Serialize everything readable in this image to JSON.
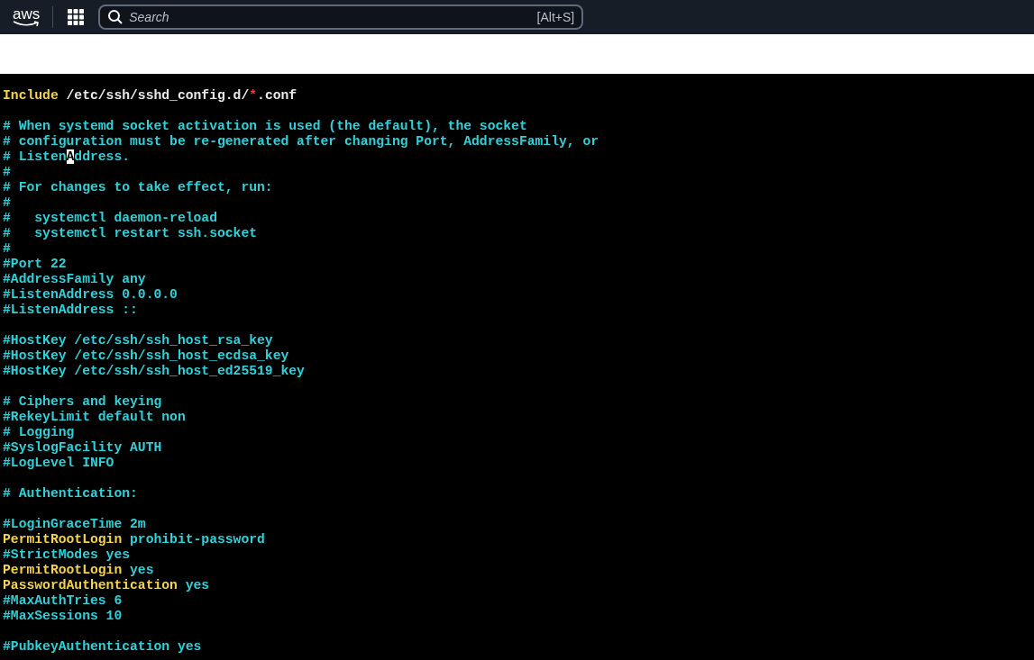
{
  "top_bar": {
    "logo": "aws",
    "search": {
      "placeholder": "Search",
      "shortcut": "[Alt+S]"
    }
  },
  "terminal": {
    "lines": [
      {
        "kind": "text",
        "segments": [
          {
            "kind": "keyword",
            "text": "Include"
          },
          {
            "kind": "plain",
            "text": " /etc/ssh/sshd_config.d/"
          },
          {
            "kind": "glob",
            "text": "*"
          },
          {
            "kind": "plain",
            "text": ".conf"
          }
        ]
      },
      {
        "kind": "blank"
      },
      {
        "kind": "text",
        "segments": [
          {
            "kind": "comment",
            "text": "# When systemd socket activation is used (the default), the socket"
          }
        ]
      },
      {
        "kind": "text",
        "segments": [
          {
            "kind": "comment",
            "text": "# configuration must be re-generated after changing Port, AddressFamily, or"
          }
        ]
      },
      {
        "kind": "text",
        "segments": [
          {
            "kind": "comment",
            "text": "# Listen"
          },
          {
            "kind": "cursor",
            "text": "A"
          },
          {
            "kind": "comment",
            "text": "ddress."
          }
        ]
      },
      {
        "kind": "text",
        "segments": [
          {
            "kind": "comment",
            "text": "#"
          }
        ]
      },
      {
        "kind": "text",
        "segments": [
          {
            "kind": "comment",
            "text": "# For changes to take effect, run:"
          }
        ]
      },
      {
        "kind": "text",
        "segments": [
          {
            "kind": "comment",
            "text": "#"
          }
        ]
      },
      {
        "kind": "text",
        "segments": [
          {
            "kind": "comment",
            "text": "#   systemctl daemon-reload"
          }
        ]
      },
      {
        "kind": "text",
        "segments": [
          {
            "kind": "comment",
            "text": "#   systemctl restart ssh.socket"
          }
        ]
      },
      {
        "kind": "text",
        "segments": [
          {
            "kind": "comment",
            "text": "#"
          }
        ]
      },
      {
        "kind": "text",
        "segments": [
          {
            "kind": "comment",
            "text": "#Port 22"
          }
        ]
      },
      {
        "kind": "text",
        "segments": [
          {
            "kind": "comment",
            "text": "#AddressFamily any"
          }
        ]
      },
      {
        "kind": "text",
        "segments": [
          {
            "kind": "comment",
            "text": "#ListenAddress 0.0.0.0"
          }
        ]
      },
      {
        "kind": "text",
        "segments": [
          {
            "kind": "comment",
            "text": "#ListenAddress ::"
          }
        ]
      },
      {
        "kind": "blank"
      },
      {
        "kind": "text",
        "segments": [
          {
            "kind": "comment",
            "text": "#HostKey /etc/ssh/ssh_host_rsa_key"
          }
        ]
      },
      {
        "kind": "text",
        "segments": [
          {
            "kind": "comment",
            "text": "#HostKey /etc/ssh/ssh_host_ecdsa_key"
          }
        ]
      },
      {
        "kind": "text",
        "segments": [
          {
            "kind": "comment",
            "text": "#HostKey /etc/ssh/ssh_host_ed25519_key"
          }
        ]
      },
      {
        "kind": "blank"
      },
      {
        "kind": "text",
        "segments": [
          {
            "kind": "comment",
            "text": "# Ciphers and keying"
          }
        ]
      },
      {
        "kind": "text",
        "segments": [
          {
            "kind": "comment",
            "text": "#RekeyLimit default non"
          }
        ]
      },
      {
        "kind": "text",
        "segments": [
          {
            "kind": "comment",
            "text": "# Logging"
          }
        ]
      },
      {
        "kind": "text",
        "segments": [
          {
            "kind": "comment",
            "text": "#SyslogFacility AUTH"
          }
        ]
      },
      {
        "kind": "text",
        "segments": [
          {
            "kind": "comment",
            "text": "#LogLevel INFO"
          }
        ]
      },
      {
        "kind": "blank"
      },
      {
        "kind": "text",
        "segments": [
          {
            "kind": "comment",
            "text": "# Authentication:"
          }
        ]
      },
      {
        "kind": "blank"
      },
      {
        "kind": "text",
        "segments": [
          {
            "kind": "comment",
            "text": "#LoginGraceTime 2m"
          }
        ]
      },
      {
        "kind": "text",
        "segments": [
          {
            "kind": "keyword",
            "text": "PermitRootLogin"
          },
          {
            "kind": "comment",
            "text": " prohibit-password"
          }
        ]
      },
      {
        "kind": "text",
        "segments": [
          {
            "kind": "comment",
            "text": "#StrictModes yes"
          }
        ]
      },
      {
        "kind": "text",
        "segments": [
          {
            "kind": "keyword",
            "text": "PermitRootLogin"
          },
          {
            "kind": "comment",
            "text": " yes"
          }
        ]
      },
      {
        "kind": "text",
        "segments": [
          {
            "kind": "keyword",
            "text": "PasswordAuthentication"
          },
          {
            "kind": "comment",
            "text": " yes"
          }
        ]
      },
      {
        "kind": "text",
        "segments": [
          {
            "kind": "comment",
            "text": "#MaxAuthTries 6"
          }
        ]
      },
      {
        "kind": "text",
        "segments": [
          {
            "kind": "comment",
            "text": "#MaxSessions 10"
          }
        ]
      },
      {
        "kind": "blank"
      },
      {
        "kind": "text",
        "segments": [
          {
            "kind": "comment",
            "text": "#PubkeyAuthentication yes"
          }
        ]
      }
    ]
  }
}
